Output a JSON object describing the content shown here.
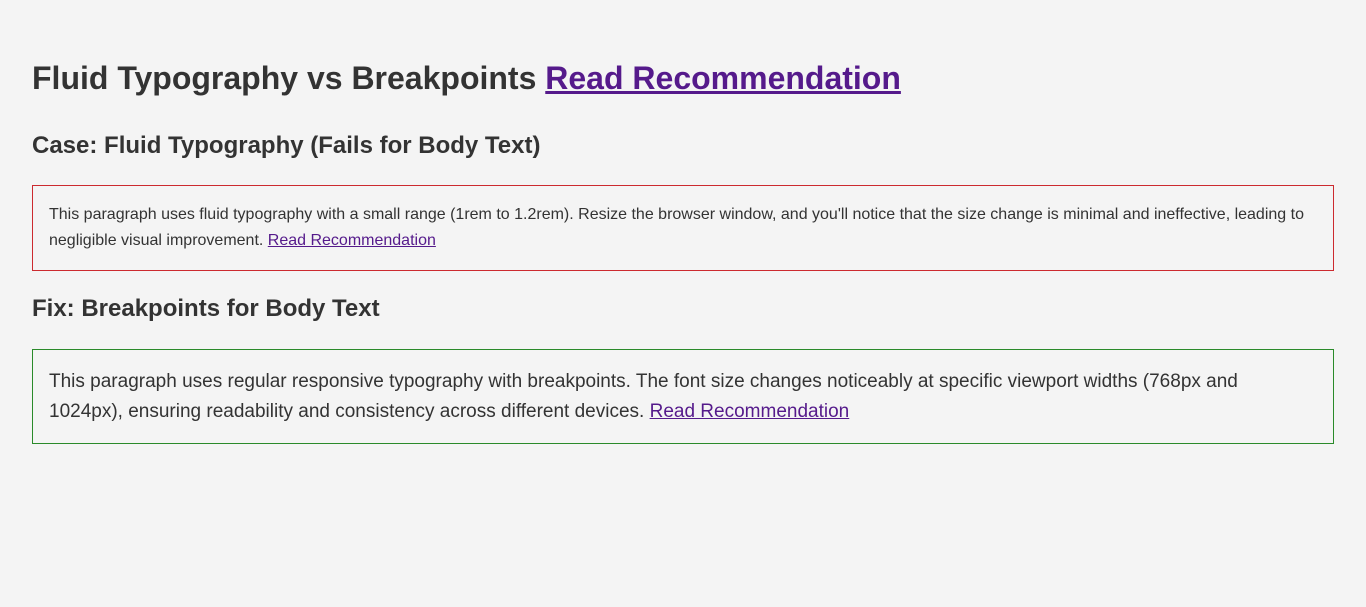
{
  "header": {
    "title": "Fluid Typography vs Breakpoints",
    "link_label": "Read Recommendation"
  },
  "case_section": {
    "heading": "Case: Fluid Typography (Fails for Body Text)",
    "paragraph": "This paragraph uses fluid typography with a small range (1rem to 1.2rem). Resize the browser window, and you'll notice that the size change is minimal and ineffective, leading to negligible visual improvement.",
    "link_label": "Read Recommendation",
    "border_color": "#cc2a2f"
  },
  "fix_section": {
    "heading": "Fix: Breakpoints for Body Text",
    "paragraph": "This paragraph uses regular responsive typography with breakpoints. The font size changes noticeably at specific viewport widths (768px and 1024px), ensuring readability and consistency across different devices.",
    "link_label": "Read Recommendation",
    "border_color": "#2a8a2a"
  },
  "colors": {
    "background": "#f4f4f4",
    "text": "#333333",
    "link": "#551a8b"
  }
}
